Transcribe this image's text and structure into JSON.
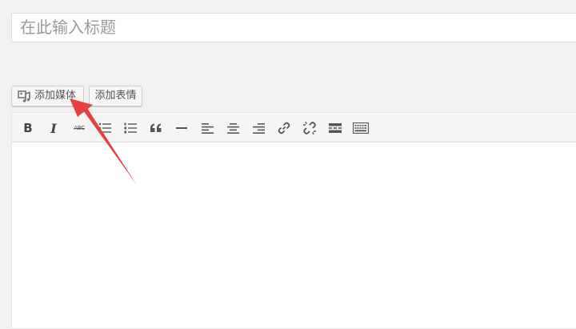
{
  "title": {
    "placeholder": "在此输入标题"
  },
  "buttons": {
    "add_media": "添加媒体",
    "add_emoji": "添加表情"
  },
  "toolbar": {
    "bold": "B",
    "italic": "I",
    "strikethrough": "ABC",
    "items": [
      "bold",
      "italic",
      "strikethrough",
      "bulleted-list",
      "numbered-list",
      "blockquote",
      "horizontal-line",
      "align-left",
      "align-center",
      "align-right",
      "insert-link",
      "remove-link",
      "read-more",
      "toolbar-toggle"
    ]
  },
  "colors": {
    "arrow": "#e8403f",
    "background": "#f1f1f1"
  },
  "icons": {
    "media": "media-icon"
  }
}
